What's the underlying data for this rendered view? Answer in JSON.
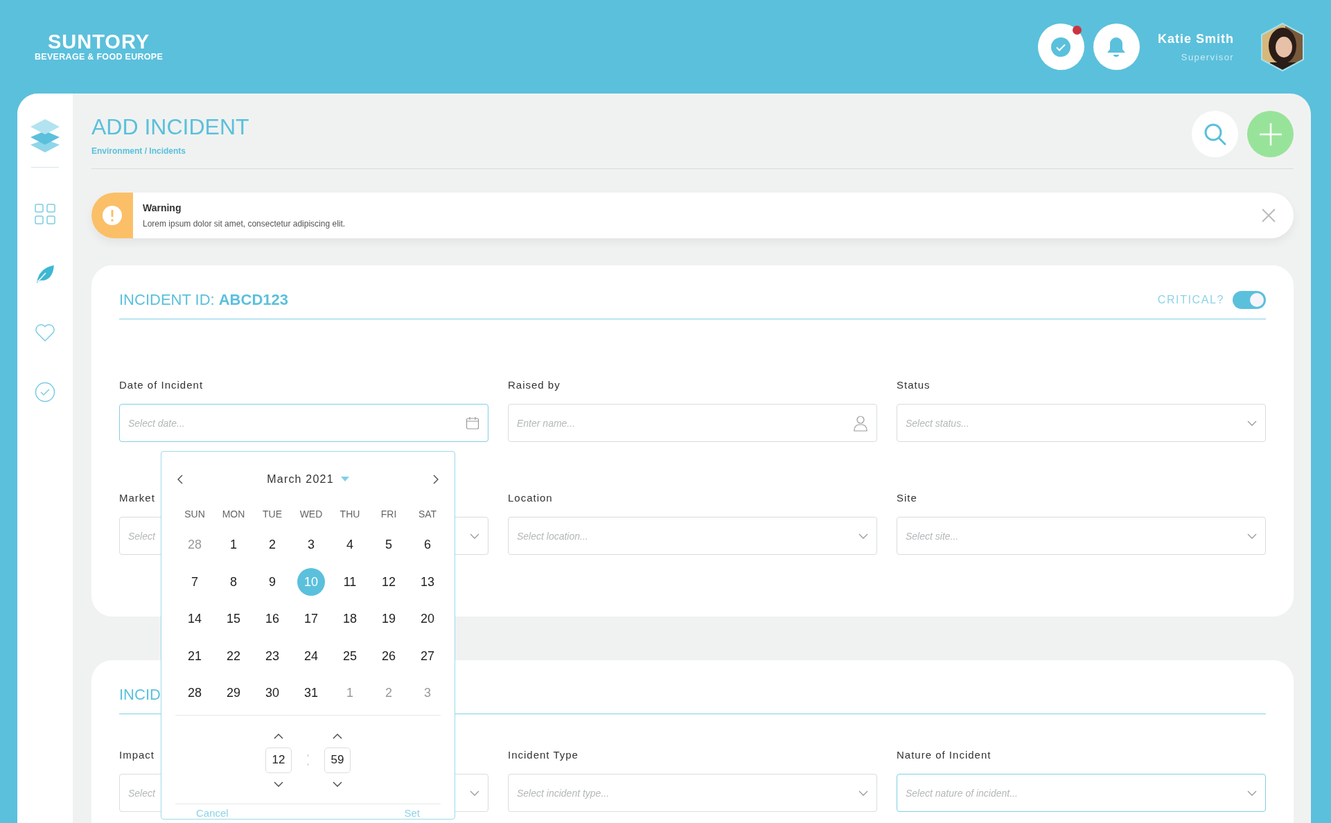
{
  "header": {
    "logo": {
      "name": "SUNTORY",
      "tagline": "BEVERAGE & FOOD EUROPE"
    },
    "tasks_badge": true,
    "user": {
      "name": "Katie Smith",
      "role": "Supervisor"
    }
  },
  "sidebar": {
    "items": [
      {
        "kind": "grid",
        "selected": false
      },
      {
        "kind": "leaf",
        "selected": true
      },
      {
        "kind": "heart",
        "selected": false
      },
      {
        "kind": "check",
        "selected": false
      }
    ]
  },
  "page": {
    "title": "ADD INCIDENT",
    "breadcrumb": "Environment / Incidents"
  },
  "alert": {
    "kind": "warning",
    "title": "Warning",
    "message": "Lorem ipsum dolor sit amet, consectetur adipiscing elit."
  },
  "incident_card": {
    "id_label": "INCIDENT ID:",
    "id_value": "ABCD123",
    "critical": {
      "label": "CRITICAL?",
      "on": true
    },
    "fields": [
      {
        "label": "Date of Incident",
        "placeholder": "Select date...",
        "kind": "date",
        "active": true
      },
      {
        "label": "Raised by",
        "placeholder": "Enter name...",
        "kind": "person",
        "active": false
      },
      {
        "label": "Status",
        "placeholder": "Select status...",
        "kind": "select",
        "active": false
      },
      {
        "label": "Market",
        "placeholder": "Select",
        "kind": "select",
        "active": false
      },
      {
        "label": "Location",
        "placeholder": "Select location...",
        "kind": "select",
        "active": false
      },
      {
        "label": "Site",
        "placeholder": "Select site...",
        "kind": "select",
        "active": false
      }
    ]
  },
  "second_card": {
    "title": "INCID",
    "fields": [
      {
        "label": "Impact",
        "placeholder": "Select",
        "kind": "select",
        "active": false
      },
      {
        "label": "Incident Type",
        "placeholder": "Select incident type...",
        "kind": "select",
        "active": false
      },
      {
        "label": "Nature of Incident",
        "placeholder": "Select nature of incident...",
        "kind": "select",
        "active": true
      }
    ]
  },
  "date_picker": {
    "month": "March 2021",
    "weekdays": [
      "SUN",
      "MON",
      "TUE",
      "WED",
      "THU",
      "FRI",
      "SAT"
    ],
    "days": [
      {
        "label": "28",
        "outside": true,
        "selected": false
      },
      {
        "label": "1",
        "outside": false,
        "selected": false
      },
      {
        "label": "2",
        "outside": false,
        "selected": false
      },
      {
        "label": "3",
        "outside": false,
        "selected": false
      },
      {
        "label": "4",
        "outside": false,
        "selected": false
      },
      {
        "label": "5",
        "outside": false,
        "selected": false
      },
      {
        "label": "6",
        "outside": false,
        "selected": false
      },
      {
        "label": "7",
        "outside": false,
        "selected": false
      },
      {
        "label": "8",
        "outside": false,
        "selected": false
      },
      {
        "label": "9",
        "outside": false,
        "selected": false
      },
      {
        "label": "10",
        "outside": false,
        "selected": true
      },
      {
        "label": "11",
        "outside": false,
        "selected": false
      },
      {
        "label": "12",
        "outside": false,
        "selected": false
      },
      {
        "label": "13",
        "outside": false,
        "selected": false
      },
      {
        "label": "14",
        "outside": false,
        "selected": false
      },
      {
        "label": "15",
        "outside": false,
        "selected": false
      },
      {
        "label": "16",
        "outside": false,
        "selected": false
      },
      {
        "label": "17",
        "outside": false,
        "selected": false
      },
      {
        "label": "18",
        "outside": false,
        "selected": false
      },
      {
        "label": "19",
        "outside": false,
        "selected": false
      },
      {
        "label": "20",
        "outside": false,
        "selected": false
      },
      {
        "label": "21",
        "outside": false,
        "selected": false
      },
      {
        "label": "22",
        "outside": false,
        "selected": false
      },
      {
        "label": "23",
        "outside": false,
        "selected": false
      },
      {
        "label": "24",
        "outside": false,
        "selected": false
      },
      {
        "label": "25",
        "outside": false,
        "selected": false
      },
      {
        "label": "26",
        "outside": false,
        "selected": false
      },
      {
        "label": "27",
        "outside": false,
        "selected": false
      },
      {
        "label": "28",
        "outside": false,
        "selected": false
      },
      {
        "label": "29",
        "outside": false,
        "selected": false
      },
      {
        "label": "30",
        "outside": false,
        "selected": false
      },
      {
        "label": "31",
        "outside": false,
        "selected": false
      },
      {
        "label": "1",
        "outside": true,
        "selected": false
      },
      {
        "label": "2",
        "outside": true,
        "selected": false
      },
      {
        "label": "3",
        "outside": true,
        "selected": false
      }
    ],
    "time": {
      "hour": "12",
      "minute": "59"
    },
    "buttons": [
      "Cancel",
      "Set"
    ]
  }
}
